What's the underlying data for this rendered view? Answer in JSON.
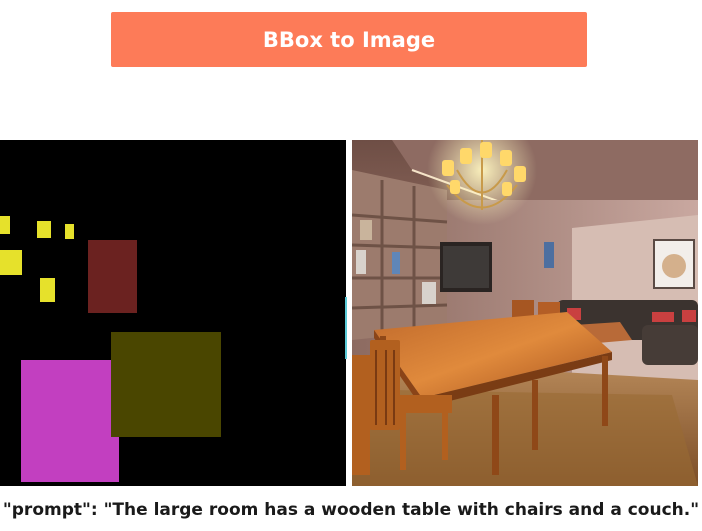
{
  "header": {
    "button_label": "BBox to Image",
    "color": "#fd7b58"
  },
  "bbox_panel": {
    "background": "#000000",
    "boxes": [
      {
        "name": "bbox-yellow-1",
        "color": "#e6e12b"
      },
      {
        "name": "bbox-yellow-2",
        "color": "#e6e12b"
      },
      {
        "name": "bbox-yellow-3",
        "color": "#e6e12b"
      },
      {
        "name": "bbox-yellow-4",
        "color": "#e6e12b"
      },
      {
        "name": "bbox-yellow-5",
        "color": "#e6e12b"
      },
      {
        "name": "bbox-dark-red",
        "color": "#6b2220"
      },
      {
        "name": "bbox-olive",
        "color": "#4a4600"
      },
      {
        "name": "bbox-magenta",
        "color": "#c23fc0"
      }
    ]
  },
  "generated_image": {
    "icon": "generated-room-image"
  },
  "caption": {
    "text": "\"prompt\": \"The large room has a wooden table with chairs and a couch.\""
  }
}
